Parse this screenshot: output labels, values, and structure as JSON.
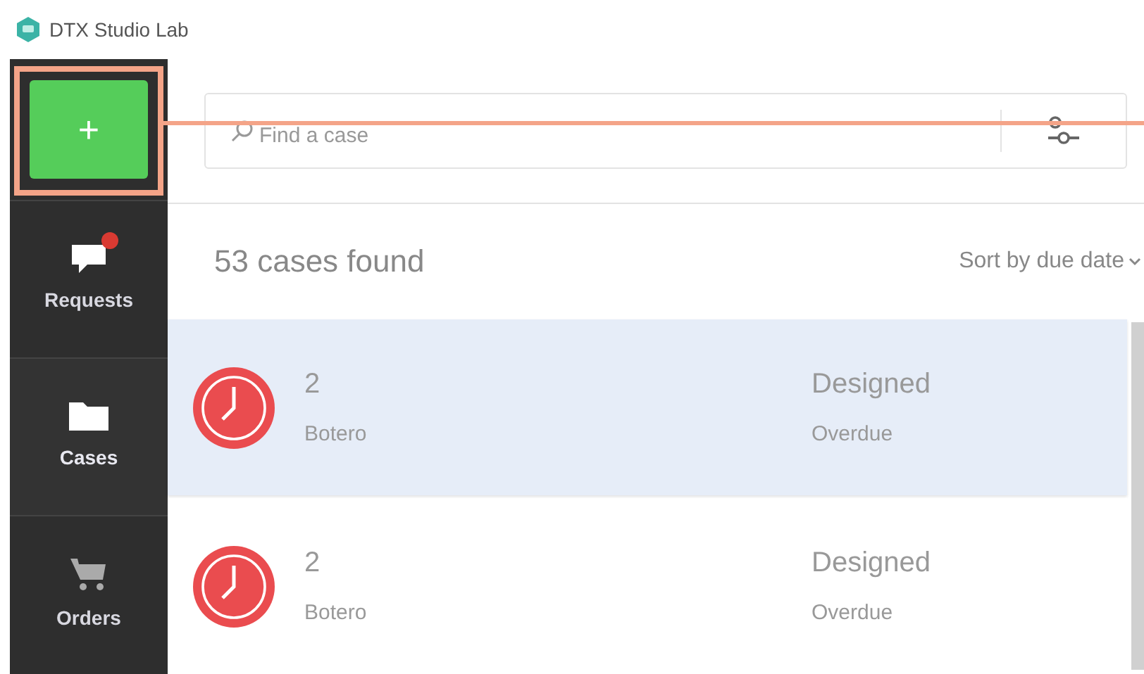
{
  "window": {
    "title": "DTX Studio Lab"
  },
  "sidebar": {
    "new_button": {
      "label": "+",
      "highlighted": true
    },
    "items": [
      {
        "label": "Requests",
        "kind": "requests",
        "selected": false,
        "badge": true
      },
      {
        "label": "Cases",
        "kind": "cases",
        "selected": true,
        "badge": false
      },
      {
        "label": "Orders",
        "kind": "orders",
        "selected": false,
        "badge": false
      }
    ]
  },
  "search": {
    "placeholder": "Find a case"
  },
  "results": {
    "count": "53 cases found",
    "sort": "Sort by due date"
  },
  "cases": [
    {
      "number": "2",
      "name": "Botero",
      "status": "Designed",
      "due": "Overdue",
      "selected": true
    },
    {
      "number": "2",
      "name": "Botero",
      "status": "Designed",
      "due": "Overdue",
      "selected": false
    }
  ]
}
